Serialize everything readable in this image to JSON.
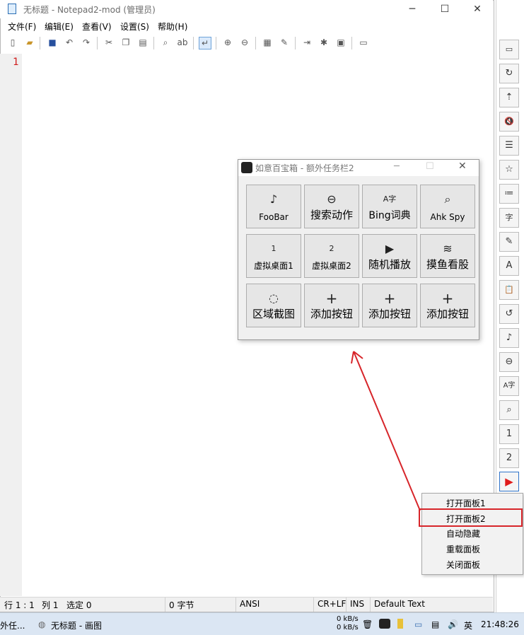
{
  "notepad": {
    "title": "无标题 - Notepad2-mod (管理员)",
    "menu": [
      "文件(F)",
      "编辑(E)",
      "查看(V)",
      "设置(S)",
      "帮助(H)"
    ],
    "line_number": "1",
    "status": {
      "pos": "行 1 : 1",
      "col": "列 1",
      "sel": "选定 0",
      "bytes": "0 字节",
      "encoding": "ANSI",
      "eol": "CR+LF",
      "mode": "INS",
      "scheme": "Default Text"
    }
  },
  "panel": {
    "title": "如意百宝箱 - 额外任务栏2",
    "buttons": [
      {
        "icon": "♪",
        "label": "FooBar"
      },
      {
        "icon": "⊖",
        "label": "搜索动作"
      },
      {
        "icon": "A字",
        "label": "Bing词典"
      },
      {
        "icon": "⌕",
        "label": "Ahk Spy"
      },
      {
        "icon": "1",
        "label": "虚拟桌面1"
      },
      {
        "icon": "2",
        "label": "虚拟桌面2"
      },
      {
        "icon": "▶",
        "label": "随机播放"
      },
      {
        "icon": "≋",
        "label": "摸鱼看股"
      },
      {
        "icon": "◌",
        "label": "区域截图"
      },
      {
        "icon": "+",
        "label": "添加按钮"
      },
      {
        "icon": "+",
        "label": "添加按钮"
      },
      {
        "icon": "+",
        "label": "添加按钮"
      }
    ]
  },
  "context_menu": {
    "items": [
      "打开面板1",
      "打开面板2",
      "自动隐藏",
      "重载面板",
      "关闭面板"
    ]
  },
  "sidebar": {
    "buttons": [
      "▭",
      "↻",
      "⇡",
      "🔇",
      "☰",
      "☆",
      "≔",
      "字",
      "✎",
      "A",
      "📋",
      "↺",
      "♪",
      "⊖",
      "A字",
      "⌕",
      "1",
      "2",
      "▶"
    ]
  },
  "taskbar": {
    "left_item": "外任...",
    "app_item": "无标题 - 画图",
    "net_up": "0 kB/s",
    "net_down": "0 kB/s",
    "ime": "英",
    "clock": "21:48:26"
  },
  "colors": {
    "highlight": "#d7252a",
    "line_number": "#d01c1c",
    "play_icon": "#e01b1b"
  }
}
